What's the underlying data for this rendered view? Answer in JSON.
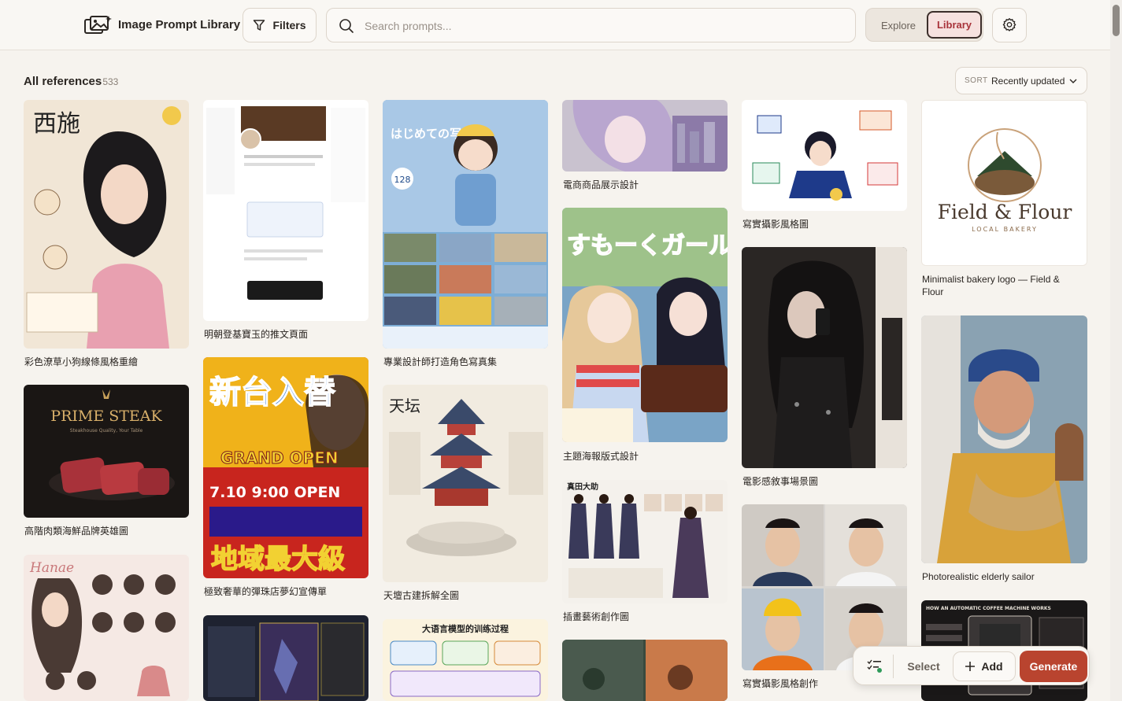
{
  "app": {
    "brand": "Image Prompt Library",
    "filters_label": "Filters",
    "search_placeholder": "Search prompts...",
    "tabs": [
      {
        "label": "Explore",
        "active": false
      },
      {
        "label": "Library",
        "active": true
      }
    ]
  },
  "gallery": {
    "heading": "All references",
    "count": "· 533",
    "sort_label": "SORT",
    "sort_value": "Recently updated"
  },
  "cards": [
    {
      "caption": "彩色潦草小狗線條風格重繪",
      "image": "colorful doodle portrait illustration",
      "bg": "#f1e6d6",
      "accent": "#e8a0b0"
    },
    {
      "caption": "高階肉類海鮮品牌英雄圖",
      "image": "PRIME STEAK",
      "bg": "#1a1614",
      "accent": "#c9a25a"
    },
    {
      "caption": "",
      "image": "Hanae character expression sheet",
      "bg": "#f5e9e4",
      "accent": "#4a3a34"
    },
    {
      "caption": "明朝登基寶玉的推文頁面",
      "image": "social media post screenshot",
      "bg": "#ffffff",
      "accent": "#3a5a9a"
    },
    {
      "caption": "極致奢華的彈珠店夢幻宣傳單",
      "image": "pachinko grand opening flyer",
      "bg": "#c8251e",
      "accent": "#f2d132"
    },
    {
      "caption": "",
      "image": "dark fantasy game card",
      "bg": "#1e2230",
      "accent": "#8a7a3a"
    },
    {
      "caption": "專業設計師打造角色寫真集",
      "image": "chibi photo book collage",
      "bg": "#7eaed6",
      "accent": "#f2c94c"
    },
    {
      "caption": "天壇古建拆解全圖",
      "image": "temple architecture breakdown",
      "bg": "#f1ebe0",
      "accent": "#3a4a6a"
    },
    {
      "caption": "",
      "image": "LLM training infographic",
      "bg": "#fbf3df",
      "accent": "#4a8ac6"
    },
    {
      "caption": "電商商品展示設計",
      "image": "anime girl city scene",
      "bg": "#c9c2cf",
      "accent": "#8c7aa8"
    },
    {
      "caption": "主題海報版式設計",
      "image": "anime girls poster",
      "bg": "#7aa4c6",
      "accent": "#e8487a"
    },
    {
      "caption": "插畫藝術創作圖",
      "image": "warrior character design sheet",
      "bg": "#f4f1ec",
      "accent": "#3a3a5a"
    },
    {
      "caption": "",
      "image": "cinematic scenes collage",
      "bg": "#3a4a3e",
      "accent": "#c97a4a"
    },
    {
      "caption": "寫實攝影風格圖",
      "image": "developer doodle illustration",
      "bg": "#ffffff",
      "accent": "#1e3a8a"
    },
    {
      "caption": "電影感敘事場景圖",
      "image": "gothic mirror selfie",
      "bg": "#2a2624",
      "accent": "#8a8a8a"
    },
    {
      "caption": "寫實攝影風格創作",
      "image": "four portrait grid",
      "bg": "#d9d6d2",
      "accent": "#2a3a5a"
    },
    {
      "caption": "Minimalist bakery logo — Field & Flour",
      "image": "Field & Flour",
      "bg": "#ffffff",
      "accent": "#7a5a3a"
    },
    {
      "caption": "Photorealistic elderly sailor",
      "image": "elderly sailor with dog",
      "bg": "#8aa2b2",
      "accent": "#d8a23a"
    },
    {
      "caption": "",
      "image": "coffee machine infographic",
      "bg": "#1a1818",
      "accent": "#c9c2b8"
    }
  ],
  "card_texts": {
    "steak_title": "PRIME STEAK",
    "steak_sub": "Steakhouse Quality, Your Table",
    "bakery_name": "Field & Flour",
    "bakery_sub": "LOCAL BAKERY",
    "doodle_title": "西施",
    "hanae_name": "Hanae",
    "pachinko_title": "新台入替",
    "pachinko_sub": "GRAND OPEN",
    "pachinko_time": "7.10 9:00 OPEN",
    "pachinko_big": "地域最大級",
    "temple_title": "天坛",
    "photobook_title": "はじめての写真集",
    "photobook_badge": "128",
    "poster_title": "すもーくガールズ",
    "designsheet_name": "真田大助",
    "llm_title": "大语言模型的训练过程",
    "coffee_title": "HOW AN AUTOMATIC COFFEE MACHINE WORKS"
  },
  "fab": {
    "select_label": "Select",
    "add_label": "Add",
    "generate_label": "Generate"
  }
}
